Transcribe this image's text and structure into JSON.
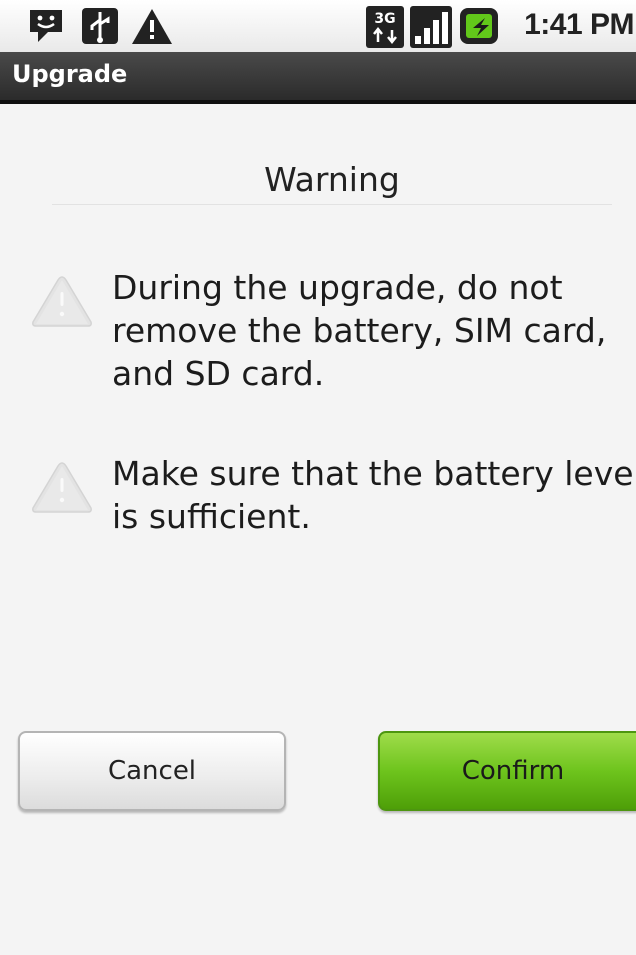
{
  "status_bar": {
    "left_icons": [
      "message-icon",
      "usb-icon",
      "alert-icon"
    ],
    "network_type": "3G",
    "right_icons": [
      "data-3g-icon",
      "signal-icon",
      "battery-charging-icon"
    ],
    "time": "1:41 PM"
  },
  "header": {
    "title": "Upgrade"
  },
  "main": {
    "heading": "Warning",
    "items": [
      {
        "icon": "warning-triangle-icon",
        "lines": [
          "During the upgrade, do not",
          "remove the battery, SIM card,",
          "and SD card."
        ]
      },
      {
        "icon": "warning-triangle-icon",
        "lines": [
          "Make sure that the battery level",
          "is sufficient."
        ]
      }
    ]
  },
  "actions": {
    "cancel_label": "Cancel",
    "confirm_label": "Confirm"
  },
  "colors": {
    "confirm_accent": "#6ec41d",
    "title_bar": "#333333",
    "background": "#f4f4f4"
  }
}
